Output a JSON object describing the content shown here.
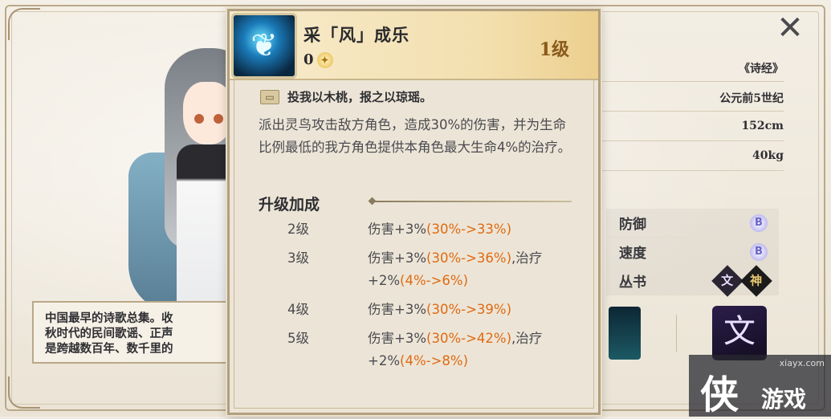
{
  "profile": {
    "source_work": "《诗经》",
    "era": "公元前5世纪",
    "height": "152cm",
    "weight": "40kg"
  },
  "stats": [
    {
      "label": "防御",
      "grade": "B"
    },
    {
      "label": "速度",
      "grade": "B"
    }
  ],
  "collection": {
    "label": "丛书",
    "tags": [
      "文",
      "神"
    ]
  },
  "lore_lines": [
    "中国最早的诗歌总集。收",
    "秋时代的民间歌谣、正声",
    "是跨越数百年、数千里的"
  ],
  "skill": {
    "name": "采「风」成乐",
    "cost": "0",
    "level": "1级",
    "quote": "投我以木桃，报之以琼瑶。",
    "description": "派出灵鸟攻击敌方角色，造成30%的伤害，并为生命比例最低的我方角色提供本角色最大生命4%的治疗。",
    "upgrade_title": "升级加成",
    "upgrades": [
      {
        "level": "2级",
        "prefix": "伤害+3%",
        "hl": "(30%->33%)",
        "suffix": "",
        "prefix2": "",
        "hl2": ""
      },
      {
        "level": "3级",
        "prefix": "伤害+3%",
        "hl": "(30%->36%)",
        "suffix": ",治疗",
        "prefix2": "+2%",
        "hl2": "(4%->6%)"
      },
      {
        "level": "4级",
        "prefix": "伤害+3%",
        "hl": "(30%->39%)",
        "suffix": "",
        "prefix2": "",
        "hl2": ""
      },
      {
        "level": "5级",
        "prefix": "伤害+3%",
        "hl": "(30%->42%)",
        "suffix": ",治疗",
        "prefix2": "+2%",
        "hl2": "(4%->8%)"
      }
    ]
  },
  "watermark": {
    "site": "xiayx.com",
    "logo": "侠",
    "text": "游戏"
  },
  "colors": {
    "highlight": "#e06a12",
    "card_bg": "#ece5d7",
    "header_gold": "#eccf8e"
  }
}
